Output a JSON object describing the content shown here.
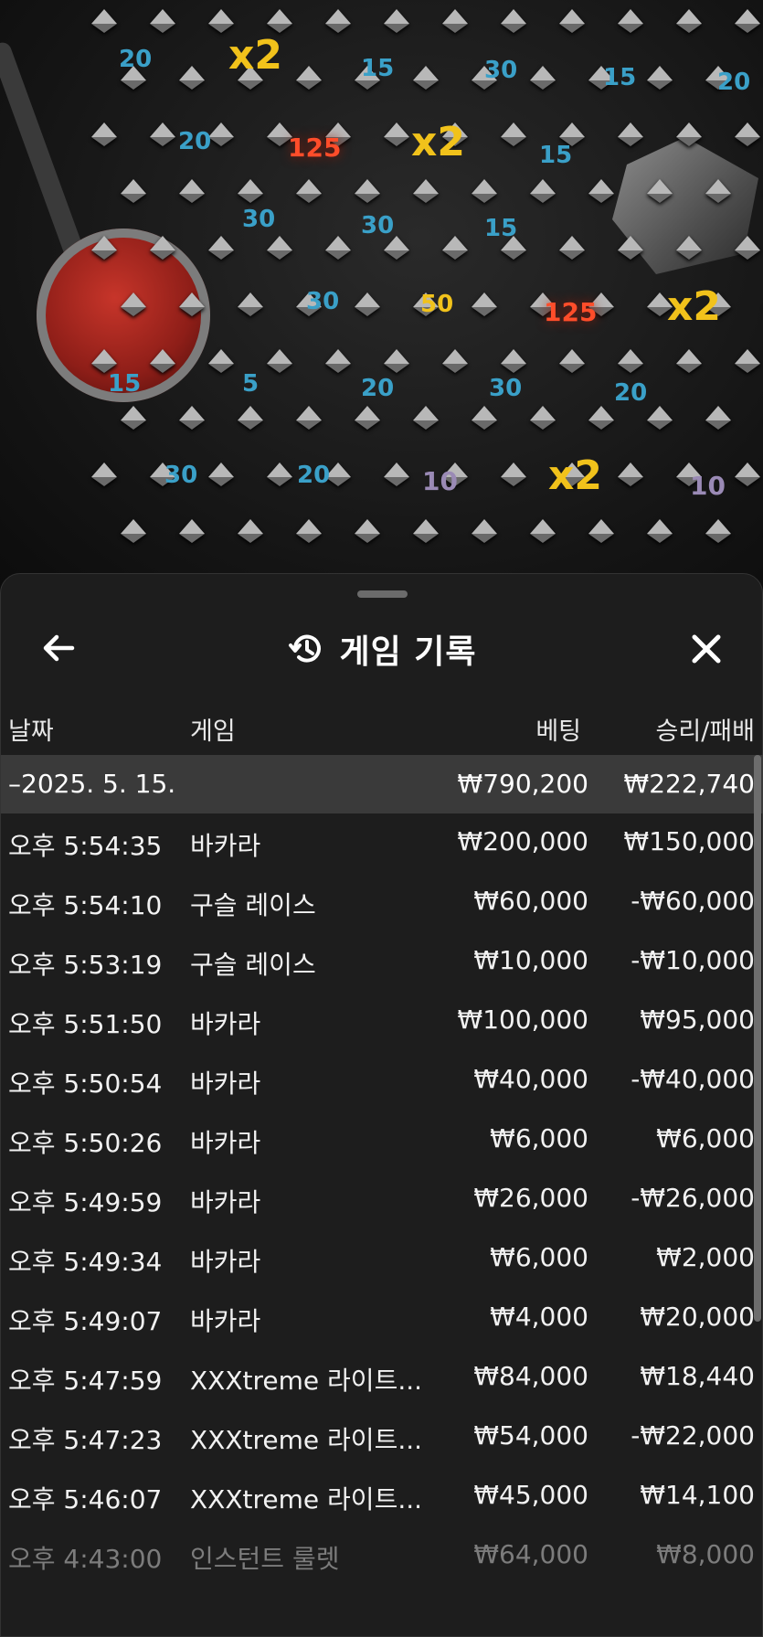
{
  "board": {
    "cells": [
      {
        "text": "20",
        "color": "blue"
      },
      {
        "text": "x2",
        "color": "mult"
      },
      {
        "text": "15",
        "color": "blue"
      },
      {
        "text": "30",
        "color": "blue"
      },
      {
        "text": "15",
        "color": "blue"
      },
      {
        "text": "20",
        "color": "blue"
      },
      {
        "text": "20",
        "color": "blue"
      },
      {
        "text": "125",
        "color": "red"
      },
      {
        "text": "x2",
        "color": "mult"
      },
      {
        "text": "15",
        "color": "blue"
      },
      {
        "text": "30",
        "color": "blue"
      },
      {
        "text": "30",
        "color": "blue"
      },
      {
        "text": "15",
        "color": "blue"
      },
      {
        "text": "30",
        "color": "blue"
      },
      {
        "text": "50",
        "color": "yellow"
      },
      {
        "text": "125",
        "color": "red"
      },
      {
        "text": "x2",
        "color": "mult"
      },
      {
        "text": "15",
        "color": "blue"
      },
      {
        "text": "5",
        "color": "blue"
      },
      {
        "text": "20",
        "color": "blue"
      },
      {
        "text": "30",
        "color": "blue"
      },
      {
        "text": "20",
        "color": "blue"
      },
      {
        "text": "30",
        "color": "blue"
      },
      {
        "text": "20",
        "color": "blue"
      },
      {
        "text": "10",
        "color": "purple"
      },
      {
        "text": "x2",
        "color": "mult"
      },
      {
        "text": "10",
        "color": "purple"
      }
    ]
  },
  "sheet": {
    "title": "게임 기록",
    "icons": {
      "back": "arrow-left-icon",
      "history": "history-icon",
      "close": "close-icon"
    },
    "columns": {
      "date": "날짜",
      "game": "게임",
      "bet": "베팅",
      "result": "승리/패배"
    },
    "date_summary": {
      "date": "–2025. 5. 15.",
      "bet": "₩790,200",
      "result": "₩222,740"
    },
    "rows": [
      {
        "time": "오후 5:54:35",
        "game": "바카라",
        "bet": "₩200,000",
        "result": "₩150,000"
      },
      {
        "time": "오후 5:54:10",
        "game": "구슬 레이스",
        "bet": "₩60,000",
        "result": "-₩60,000"
      },
      {
        "time": "오후 5:53:19",
        "game": "구슬 레이스",
        "bet": "₩10,000",
        "result": "-₩10,000"
      },
      {
        "time": "오후 5:51:50",
        "game": "바카라",
        "bet": "₩100,000",
        "result": "₩95,000"
      },
      {
        "time": "오후 5:50:54",
        "game": "바카라",
        "bet": "₩40,000",
        "result": "-₩40,000"
      },
      {
        "time": "오후 5:50:26",
        "game": "바카라",
        "bet": "₩6,000",
        "result": "₩6,000"
      },
      {
        "time": "오후 5:49:59",
        "game": "바카라",
        "bet": "₩26,000",
        "result": "-₩26,000"
      },
      {
        "time": "오후 5:49:34",
        "game": "바카라",
        "bet": "₩6,000",
        "result": "₩2,000"
      },
      {
        "time": "오후 5:49:07",
        "game": "바카라",
        "bet": "₩4,000",
        "result": "₩20,000"
      },
      {
        "time": "오후 5:47:59",
        "game": "XXXtreme 라이트...",
        "bet": "₩84,000",
        "result": "₩18,440"
      },
      {
        "time": "오후 5:47:23",
        "game": "XXXtreme 라이트...",
        "bet": "₩54,000",
        "result": "-₩22,000"
      },
      {
        "time": "오후 5:46:07",
        "game": "XXXtreme 라이트...",
        "bet": "₩45,000",
        "result": "₩14,100"
      },
      {
        "time": "오후 4:43:00",
        "game": "인스턴트 룰렛",
        "bet": "₩64,000",
        "result": "₩8,000"
      }
    ]
  }
}
